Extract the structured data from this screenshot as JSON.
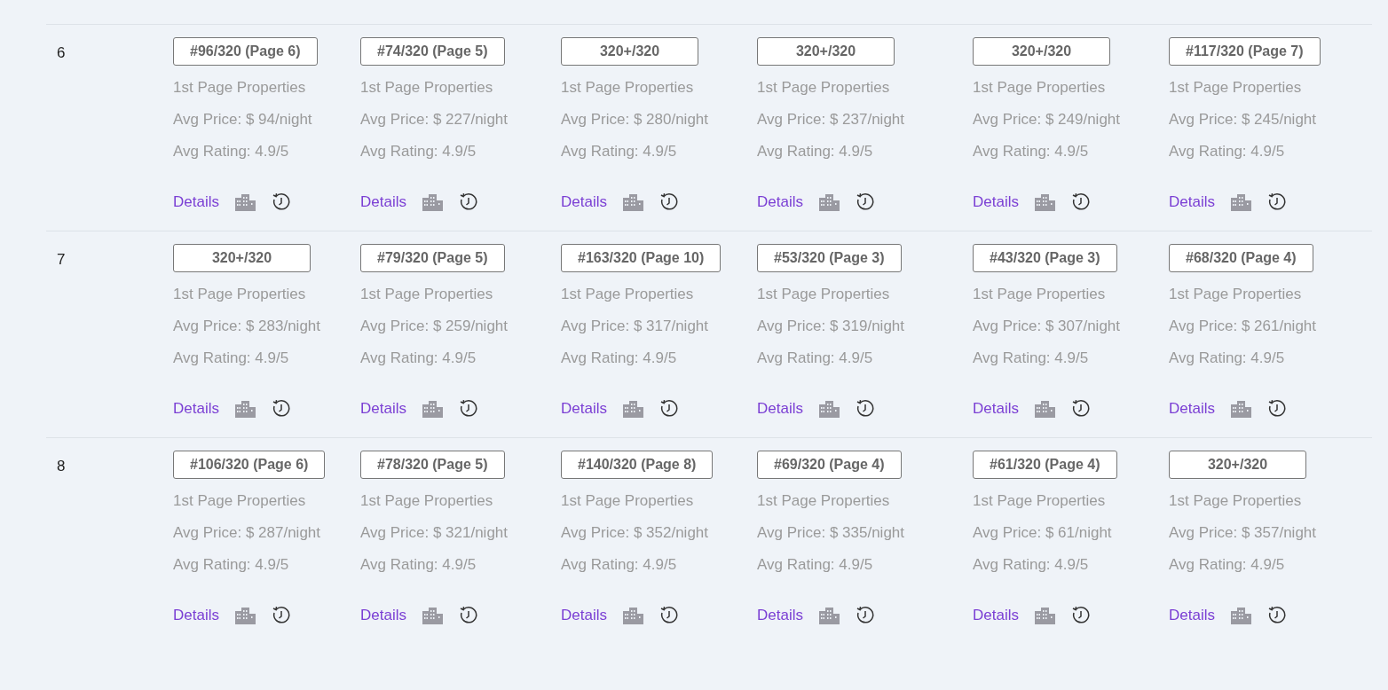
{
  "rows": [
    {
      "number": "6",
      "cells": [
        {
          "rank": "#96/320 (Page 6)",
          "label": "1st Page Properties",
          "price": "Avg Price: $ 94/night",
          "rating": "Avg Rating: 4.9/5",
          "link": "Details"
        },
        {
          "rank": "#74/320 (Page 5)",
          "label": "1st Page Properties",
          "price": "Avg Price: $ 227/night",
          "rating": "Avg Rating: 4.9/5",
          "link": "Details"
        },
        {
          "rank": "320+/320",
          "label": "1st Page Properties",
          "price": "Avg Price: $ 280/night",
          "rating": "Avg Rating: 4.9/5",
          "link": "Details"
        },
        {
          "rank": "320+/320",
          "label": "1st Page Properties",
          "price": "Avg Price: $ 237/night",
          "rating": "Avg Rating: 4.9/5",
          "link": "Details"
        },
        {
          "rank": "320+/320",
          "label": "1st Page Properties",
          "price": "Avg Price: $ 249/night",
          "rating": "Avg Rating: 4.9/5",
          "link": "Details"
        },
        {
          "rank": "#117/320 (Page 7)",
          "label": "1st Page Properties",
          "price": "Avg Price: $ 245/night",
          "rating": "Avg Rating: 4.9/5",
          "link": "Details"
        }
      ]
    },
    {
      "number": "7",
      "cells": [
        {
          "rank": "320+/320",
          "label": "1st Page Properties",
          "price": "Avg Price: $ 283/night",
          "rating": "Avg Rating: 4.9/5",
          "link": "Details"
        },
        {
          "rank": "#79/320 (Page 5)",
          "label": "1st Page Properties",
          "price": "Avg Price: $ 259/night",
          "rating": "Avg Rating: 4.9/5",
          "link": "Details"
        },
        {
          "rank": "#163/320 (Page 10)",
          "label": "1st Page Properties",
          "price": "Avg Price: $ 317/night",
          "rating": "Avg Rating: 4.9/5",
          "link": "Details"
        },
        {
          "rank": "#53/320 (Page 3)",
          "label": "1st Page Properties",
          "price": "Avg Price: $ 319/night",
          "rating": "Avg Rating: 4.9/5",
          "link": "Details"
        },
        {
          "rank": "#43/320 (Page 3)",
          "label": "1st Page Properties",
          "price": "Avg Price: $ 307/night",
          "rating": "Avg Rating: 4.9/5",
          "link": "Details"
        },
        {
          "rank": "#68/320 (Page 4)",
          "label": "1st Page Properties",
          "price": "Avg Price: $ 261/night",
          "rating": "Avg Rating: 4.9/5",
          "link": "Details"
        }
      ]
    },
    {
      "number": "8",
      "cells": [
        {
          "rank": "#106/320 (Page 6)",
          "label": "1st Page Properties",
          "price": "Avg Price: $ 287/night",
          "rating": "Avg Rating: 4.9/5",
          "link": "Details"
        },
        {
          "rank": "#78/320 (Page 5)",
          "label": "1st Page Properties",
          "price": "Avg Price: $ 321/night",
          "rating": "Avg Rating: 4.9/5",
          "link": "Details"
        },
        {
          "rank": "#140/320 (Page 8)",
          "label": "1st Page Properties",
          "price": "Avg Price: $ 352/night",
          "rating": "Avg Rating: 4.9/5",
          "link": "Details"
        },
        {
          "rank": "#69/320 (Page 4)",
          "label": "1st Page Properties",
          "price": "Avg Price: $ 335/night",
          "rating": "Avg Rating: 4.9/5",
          "link": "Details"
        },
        {
          "rank": "#61/320 (Page 4)",
          "label": "1st Page Properties",
          "price": "Avg Price: $ 61/night",
          "rating": "Avg Rating: 4.9/5",
          "link": "Details"
        },
        {
          "rank": "320+/320",
          "label": "1st Page Properties",
          "price": "Avg Price: $ 357/night",
          "rating": "Avg Rating: 4.9/5",
          "link": "Details"
        }
      ]
    }
  ]
}
